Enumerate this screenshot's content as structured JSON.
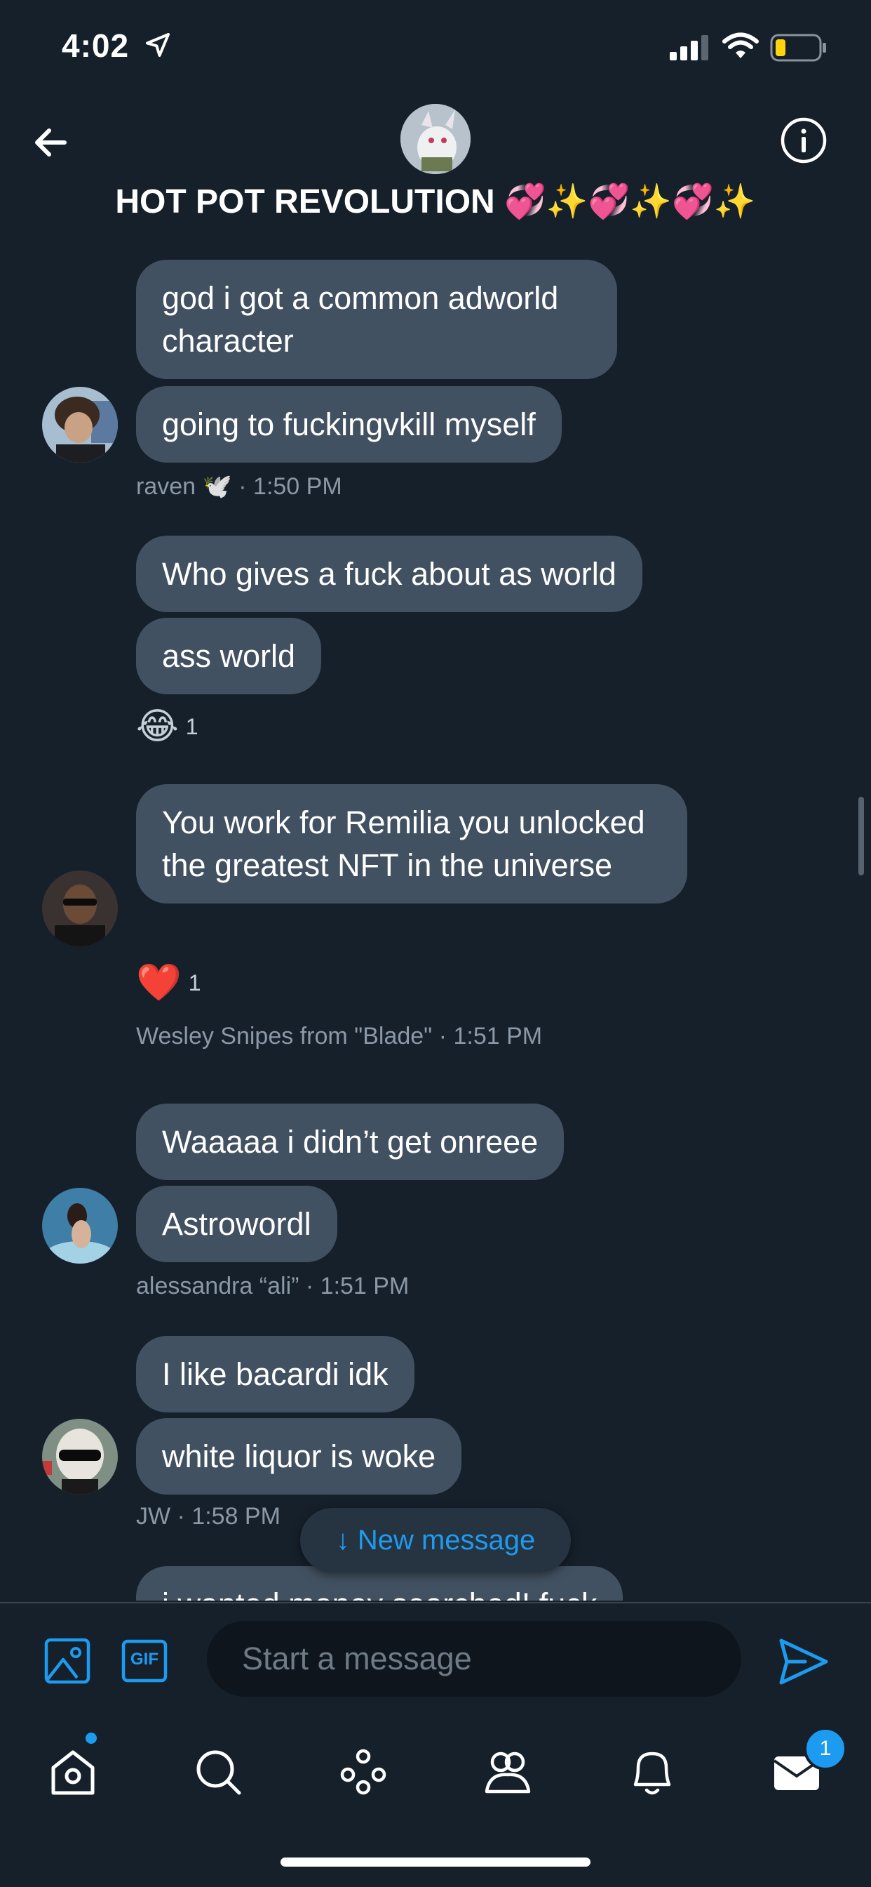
{
  "status_bar": {
    "time": "4:02"
  },
  "header": {
    "title": "HOT POT REVOLUTION 💞✨💞✨💞✨"
  },
  "messages": [
    {
      "text": "god i got a common adworld character"
    },
    {
      "text": "going to fuckingvkill myself"
    },
    {
      "text": "Who gives a fuck about as world"
    },
    {
      "text": "ass world"
    },
    {
      "text": "You work for Remilia you unlocked the greatest NFT in the universe"
    },
    {
      "text": "Waaaaa i didn’t get onreee"
    },
    {
      "text": "Astrowordl"
    },
    {
      "text": "I like bacardi idk"
    },
    {
      "text": "white liquor is woke"
    },
    {
      "text": "i wanted money searched! fuck"
    }
  ],
  "meta": [
    {
      "text": "raven 🕊️ · 1:50 PM"
    },
    {
      "text": "Wesley Snipes from \"Blade\" · 1:51 PM"
    },
    {
      "text": "alessandra “ali” · 1:51 PM"
    },
    {
      "text": "JW · 1:58 PM"
    }
  ],
  "reactions": [
    {
      "emoji": "😂",
      "count": "1"
    },
    {
      "emoji": "❤️",
      "count": "1"
    }
  ],
  "new_message_label": "↓ New message",
  "composer": {
    "placeholder": "Start a message",
    "gif_label": "GIF"
  },
  "tabbar": {
    "messages_badge": "1"
  },
  "colors": {
    "accent": "#1d9bf0",
    "background": "#15202b",
    "bubble": "#425161"
  }
}
